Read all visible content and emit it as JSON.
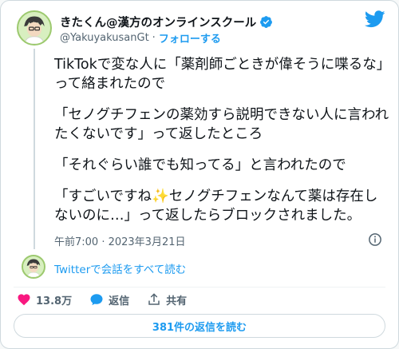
{
  "author": {
    "name": "きたくん@漢方のオンラインスクール",
    "handle": "@YakuyakusanGt",
    "separator": "·",
    "follow_label": "フォローする",
    "avatar_icon": "profile-avatar-icon",
    "verified_icon": "verified-badge-icon"
  },
  "tweet": {
    "paragraphs": [
      "TikTokで変な人に「薬剤師ごときが偉そうに喋るな」って絡まれたので",
      "「セノグチフェンの薬効すら説明できない人に言われたくないです」って返したところ",
      "「それぐらい誰でも知ってる」と言われたので"
    ],
    "last_paragraph": {
      "before": "「すごいですね",
      "sparkle": "✨",
      "after": "セノグチフェンなんて薬は存在しないのに…」って返したらブロックされました。"
    },
    "timestamp": "午前7:00 · 2023年3月21日"
  },
  "thread": {
    "link_label": "Twitterで会話をすべて読む"
  },
  "actions": {
    "like_count": "13.8万",
    "reply_label": "返信",
    "share_label": "共有"
  },
  "more_replies_label": "381件の返信を読む",
  "colors": {
    "accent": "#1d9bf0",
    "like": "#f91880",
    "text": "#0f1419",
    "muted": "#536471"
  }
}
